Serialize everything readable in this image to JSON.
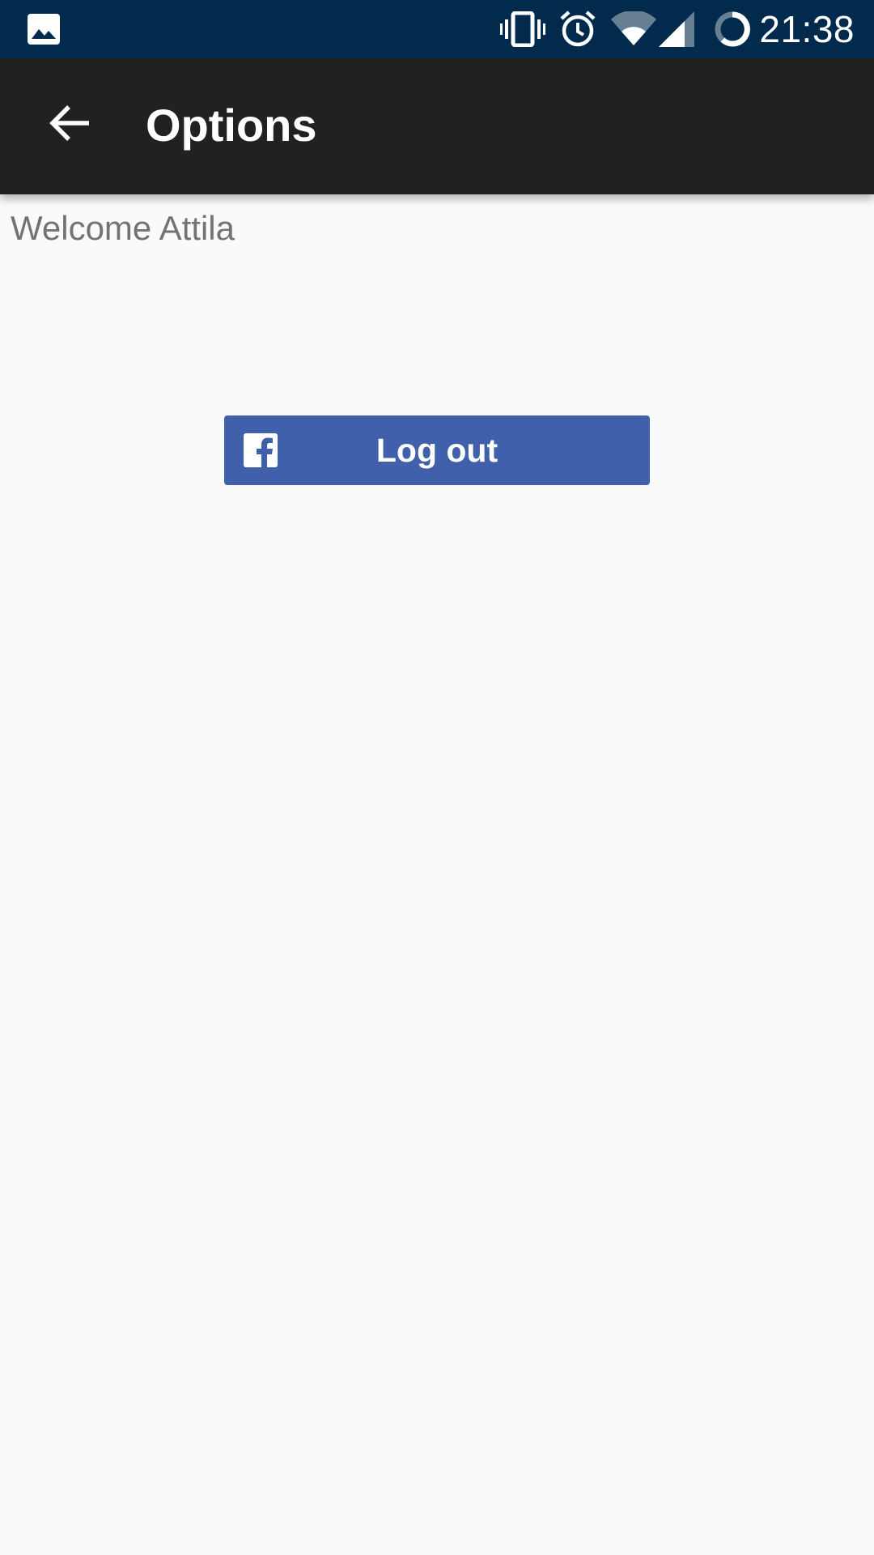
{
  "status_bar": {
    "time": "21:38",
    "icons": [
      "gallery-icon",
      "vibrate-icon",
      "alarm-icon",
      "wifi-icon",
      "signal-icon",
      "battery-icon"
    ]
  },
  "app_bar": {
    "title": "Options",
    "back_icon": "arrow-left-icon"
  },
  "content": {
    "welcome_text": "Welcome Attila",
    "logout_button": {
      "label": "Log out",
      "icon": "facebook-icon"
    }
  },
  "colors": {
    "status_bar": "#012a4c",
    "app_bar": "#212121",
    "background": "#fafafa",
    "facebook_button": "#4160ac",
    "welcome_text": "#737373"
  }
}
